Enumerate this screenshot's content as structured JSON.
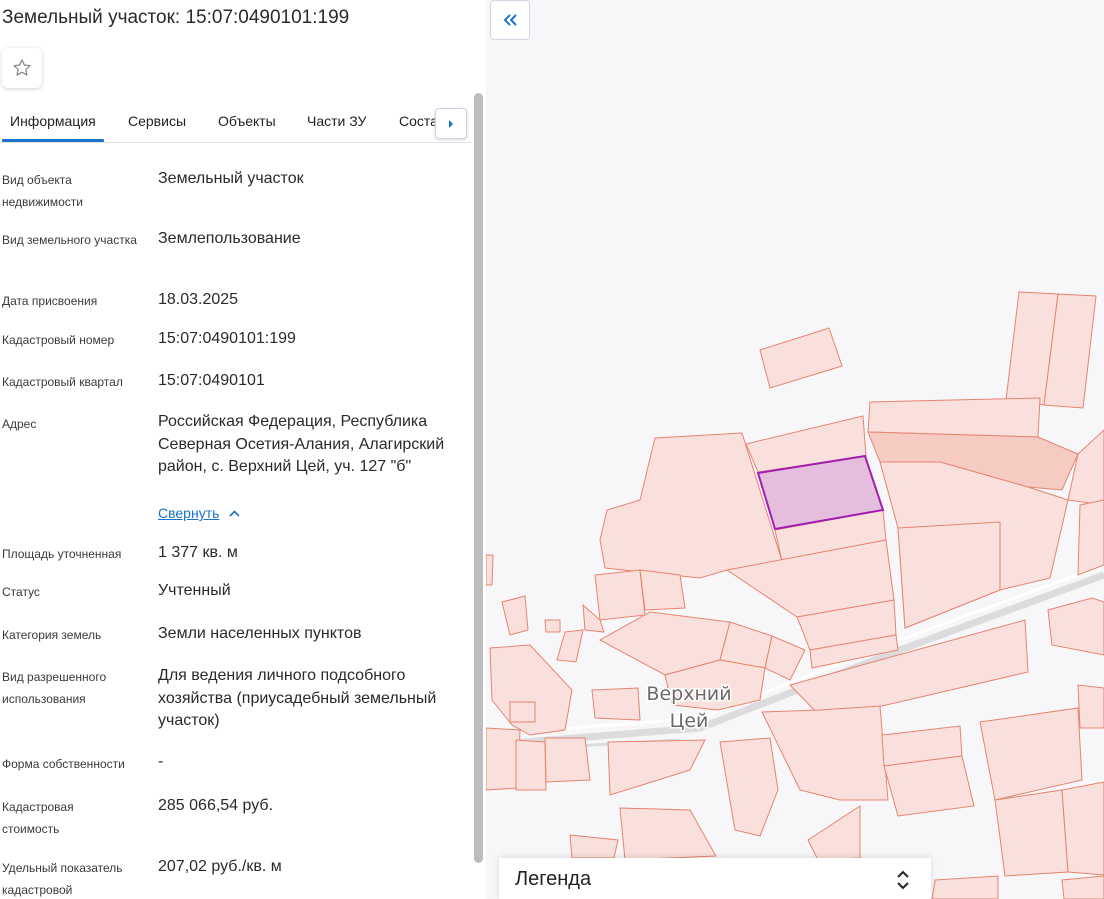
{
  "header": {
    "title": "Земельный участок: 15:07:0490101:199"
  },
  "tabs": [
    {
      "label": "Информация",
      "active": true
    },
    {
      "label": "Сервисы"
    },
    {
      "label": "Объекты"
    },
    {
      "label": "Части ЗУ"
    },
    {
      "label": "Соста…"
    }
  ],
  "fields": [
    {
      "label": "Вид объекта недвижимости",
      "value": "Земельный участок"
    },
    {
      "label": "Вид земельного участка",
      "value": "Землепользование"
    },
    {
      "label": "Дата присвоения",
      "value": "18.03.2025"
    },
    {
      "label": "Кадастровый номер",
      "value": "15:07:0490101:199"
    },
    {
      "label": "Кадастровый квартал",
      "value": "15:07:0490101"
    },
    {
      "label": "Адрес",
      "value": "Российская Федерация, Республика Северная Осетия-Алания, Алагирский район, с. Верхний Цей, уч. 127 \"б\""
    },
    {
      "label": "Площадь уточненная",
      "value": "1 377 кв. м"
    },
    {
      "label": "Статус",
      "value": "Учтенный"
    },
    {
      "label": "Категория земель",
      "value": "Земли населенных пунктов"
    },
    {
      "label": "Вид разрешенного использования",
      "value": "Для ведения личного подсобного хозяйства (приусадебный земельный участок)"
    },
    {
      "label": "Форма собственности",
      "value": "-"
    },
    {
      "label": "Кадастровая стоимость",
      "value": "285 066,54 руб."
    },
    {
      "label": "Удельный показатель кадастровой",
      "value": "207,02 руб./кв. м"
    }
  ],
  "address_collapse_label": "Свернуть",
  "map": {
    "place_label_line1": "Верхний",
    "place_label_line2": "Цей",
    "legend_title": "Легенда"
  },
  "colors": {
    "accent": "#1a73c8",
    "parcel_fill": "#f9e0dc",
    "parcel_stroke": "#e8836f",
    "selected_fill": "#e6bedd",
    "selected_stroke": "#a21caf"
  },
  "icons": {
    "favorite": "star-outline-icon",
    "tabs_next": "caret-right-icon",
    "collapse_panel": "double-chevron-left-icon",
    "collapse_address": "chevron-up-icon",
    "legend_toggle": "chevron-up-down-icon"
  }
}
